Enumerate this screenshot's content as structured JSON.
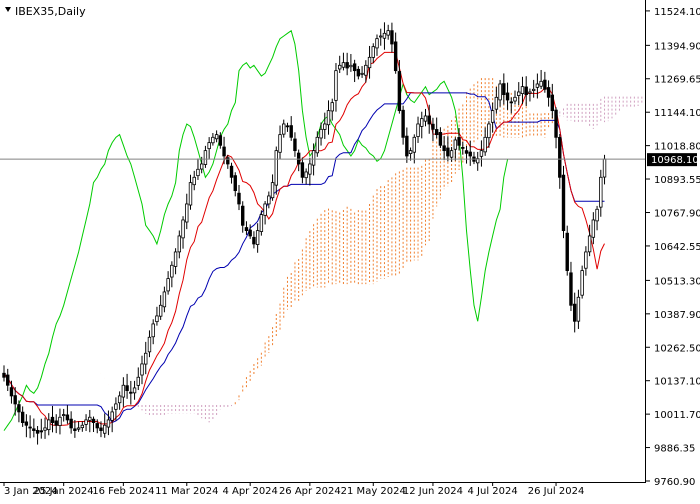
{
  "chart_data": {
    "type": "candlestick",
    "title": "IBEX35,Daily",
    "symbol": "IBEX35",
    "timeframe": "Daily",
    "current_price": "10968.10",
    "ylim": [
      9760.9,
      11550
    ],
    "y_ticks": [
      "11524.10",
      "11394.90",
      "11269.65",
      "11144.10",
      "11018.80",
      "10893.55",
      "10767.90",
      "10642.55",
      "10513.30",
      "10387.90",
      "10262.50",
      "10137.10",
      "10011.70",
      "9886.35",
      "9760.90"
    ],
    "x_ticks": [
      {
        "i": 0,
        "label": "3 Jan 2024"
      },
      {
        "i": 16,
        "label": "25 Jan 2024"
      },
      {
        "i": 32,
        "label": "16 Feb 2024"
      },
      {
        "i": 49,
        "label": "11 Mar 2024"
      },
      {
        "i": 66,
        "label": "4 Apr 2024"
      },
      {
        "i": 82,
        "label": "26 Apr 2024"
      },
      {
        "i": 99,
        "label": "21 May 2024"
      },
      {
        "i": 115,
        "label": "12 Jun 2024"
      },
      {
        "i": 131,
        "label": "4 Jul 2024"
      },
      {
        "i": 148,
        "label": "26 Jul 2024"
      }
    ],
    "indicator": "Ichimoku Kinko Hyo",
    "colors": {
      "up": "#000000",
      "down": "#000000",
      "tenkan": "#e00000",
      "kijun": "#0000b0",
      "chikou": "#00cc00",
      "cloud_a": "#f08030",
      "cloud_b": "#d0a0c0",
      "price_line": "#808080",
      "price_label_bg": "#000000"
    },
    "closes": [
      10150,
      10120,
      10080,
      10050,
      10020,
      9980,
      9970,
      9960,
      9950,
      9940,
      9945,
      9960,
      9990,
      9980,
      9970,
      10000,
      10010,
      9990,
      9960,
      9950,
      9960,
      9970,
      9990,
      10000,
      9980,
      9960,
      9950,
      9970,
      9990,
      10020,
      10050,
      10080,
      10120,
      10100,
      10090,
      10110,
      10150,
      10200,
      10240,
      10300,
      10350,
      10380,
      10420,
      10470,
      10520,
      10570,
      10620,
      10680,
      10740,
      10800,
      10880,
      10900,
      10930,
      10950,
      11000,
      11030,
      11050,
      11060,
      11020,
      10980,
      10950,
      10900,
      10850,
      10800,
      10720,
      10700,
      10680,
      10650,
      10700,
      10760,
      10800,
      10830,
      10880,
      11000,
      11060,
      11100,
      11090,
      11050,
      11000,
      10950,
      10900,
      10920,
      10950,
      11000,
      11050,
      11080,
      11100,
      11150,
      11180,
      11300,
      11320,
      11330,
      11310,
      11320,
      11300,
      11280,
      11290,
      11320,
      11350,
      11390,
      11420,
      11430,
      11440,
      11450,
      11400,
      11300,
      11150,
      11050,
      10980,
      11000,
      11050,
      11100,
      11120,
      11130,
      11100,
      11080,
      11060,
      11020,
      11000,
      10980,
      11000,
      11040,
      11020,
      11010,
      10990,
      10980,
      10960,
      10970,
      11000,
      11050,
      11100,
      11150,
      11200,
      11250,
      11210,
      11190,
      11180,
      11200,
      11220,
      11240,
      11210,
      11220,
      11230,
      11250,
      11260,
      11230,
      11200,
      11150,
      11050,
      10900,
      10700,
      10550,
      10420,
      10360,
      10450,
      10550,
      10620,
      10680,
      10740,
      10780,
      10900,
      10968
    ]
  }
}
